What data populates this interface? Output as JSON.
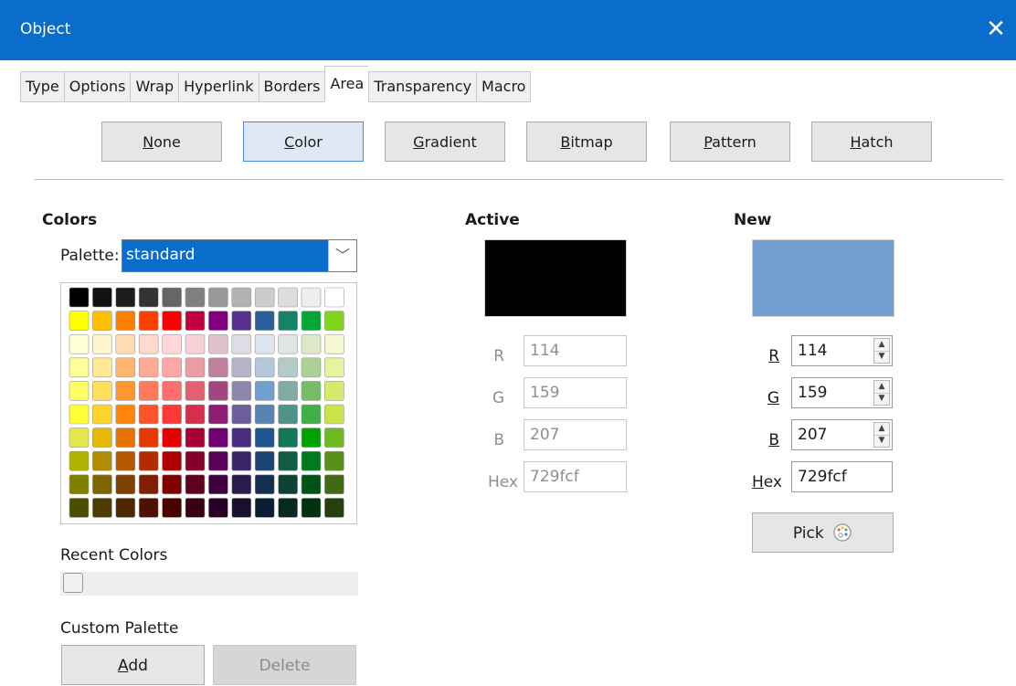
{
  "dialog": {
    "title": "Object",
    "close_icon": "close-icon"
  },
  "tabs": [
    {
      "label": "Type"
    },
    {
      "label": "Options"
    },
    {
      "label": "Wrap"
    },
    {
      "label": "Hyperlink"
    },
    {
      "label": "Borders"
    },
    {
      "label": "Area",
      "active": true
    },
    {
      "label": "Transparency"
    },
    {
      "label": "Macro"
    }
  ],
  "area_modes": [
    {
      "pre": "",
      "u": "N",
      "post": "one"
    },
    {
      "pre": "",
      "u": "C",
      "post": "olor",
      "active": true
    },
    {
      "pre": "",
      "u": "G",
      "post": "radient"
    },
    {
      "pre": "",
      "u": "B",
      "post": "itmap"
    },
    {
      "pre": "",
      "u": "P",
      "post": "attern"
    },
    {
      "pre": "",
      "u": "H",
      "post": "atch"
    }
  ],
  "colors": {
    "heading": "Colors",
    "palette_label": "Palette:",
    "palette_value": "standard",
    "swatches": [
      [
        "#000000",
        "#111111",
        "#1c1c1c",
        "#333333",
        "#666666",
        "#808080",
        "#999999",
        "#b2b2b2",
        "#cccccc",
        "#dddddd",
        "#eeeeee",
        "#ffffff"
      ],
      [
        "#ffff00",
        "#ffbf00",
        "#ff8000",
        "#ff4000",
        "#ff0000",
        "#bf0041",
        "#800080",
        "#55308d",
        "#2a6099",
        "#158466",
        "#00a933",
        "#81d41a"
      ],
      [
        "#ffffd7",
        "#fff5ce",
        "#ffdbb6",
        "#ffd8ce",
        "#ffd7d7",
        "#f7d1d5",
        "#e0c2cd",
        "#dedce6",
        "#dee6ef",
        "#dee7e5",
        "#dde8cb",
        "#f6f9d4"
      ],
      [
        "#ffff99",
        "#ffe994",
        "#ffb66c",
        "#ffaa95",
        "#ffa6a6",
        "#ec9ba4",
        "#bf819e",
        "#b7b3ca",
        "#b4c7dc",
        "#b3cac7",
        "#afd095",
        "#e8f2a1"
      ],
      [
        "#ffff66",
        "#ffde59",
        "#ff972f",
        "#ff7b59",
        "#ff6d6d",
        "#e16173",
        "#a1467e",
        "#8e86ae",
        "#729fcf",
        "#81aca6",
        "#77bc65",
        "#d4ea6b"
      ],
      [
        "#ffff38",
        "#ffd428",
        "#ff860d",
        "#ff5429",
        "#ff3838",
        "#d62e4e",
        "#8d1d75",
        "#6b5e9b",
        "#5983b0",
        "#50938a",
        "#3faf46",
        "#c9e34b"
      ],
      [
        "#e6e64c",
        "#e6b800",
        "#e67300",
        "#e63900",
        "#e60000",
        "#a80035",
        "#730073",
        "#4a2c81",
        "#1e5591",
        "#127755",
        "#00a200",
        "#6eb922"
      ],
      [
        "#b2b200",
        "#b28c00",
        "#b25900",
        "#b22c00",
        "#b20000",
        "#82002b",
        "#590059",
        "#3b2468",
        "#1a4573",
        "#0e5d44",
        "#007a1f",
        "#57911a"
      ],
      [
        "#808000",
        "#806400",
        "#804000",
        "#802000",
        "#800000",
        "#5e001f",
        "#400040",
        "#2a1a4d",
        "#142f54",
        "#0b4335",
        "#005215",
        "#3e6b13"
      ],
      [
        "#4d4d00",
        "#4d3c00",
        "#4d2600",
        "#4d1300",
        "#4d0000",
        "#390013",
        "#260026",
        "#19102e",
        "#0c1d33",
        "#072920",
        "#00330d",
        "#25400b"
      ]
    ],
    "recent_label": "Recent Colors",
    "custom_label": "Custom Palette",
    "add_pre": "",
    "add_u": "A",
    "add_post": "dd",
    "delete_label": "Delete"
  },
  "active": {
    "heading": "Active",
    "preview_color": "#000000",
    "r_label": "R",
    "r": "114",
    "g_label": "G",
    "g": "159",
    "b_label": "B",
    "b": "207",
    "hex_label": "Hex",
    "hex": "729fcf"
  },
  "new": {
    "heading": "New",
    "preview_color": "#729fcf",
    "r_label": "R",
    "r": "114",
    "g_label": "G",
    "g": "159",
    "b_label": "B",
    "b": "207",
    "hex_u": "H",
    "hex_rest": "ex",
    "hex": "729fcf",
    "pick_label": "Pick",
    "pick_icon": "palette-icon"
  }
}
